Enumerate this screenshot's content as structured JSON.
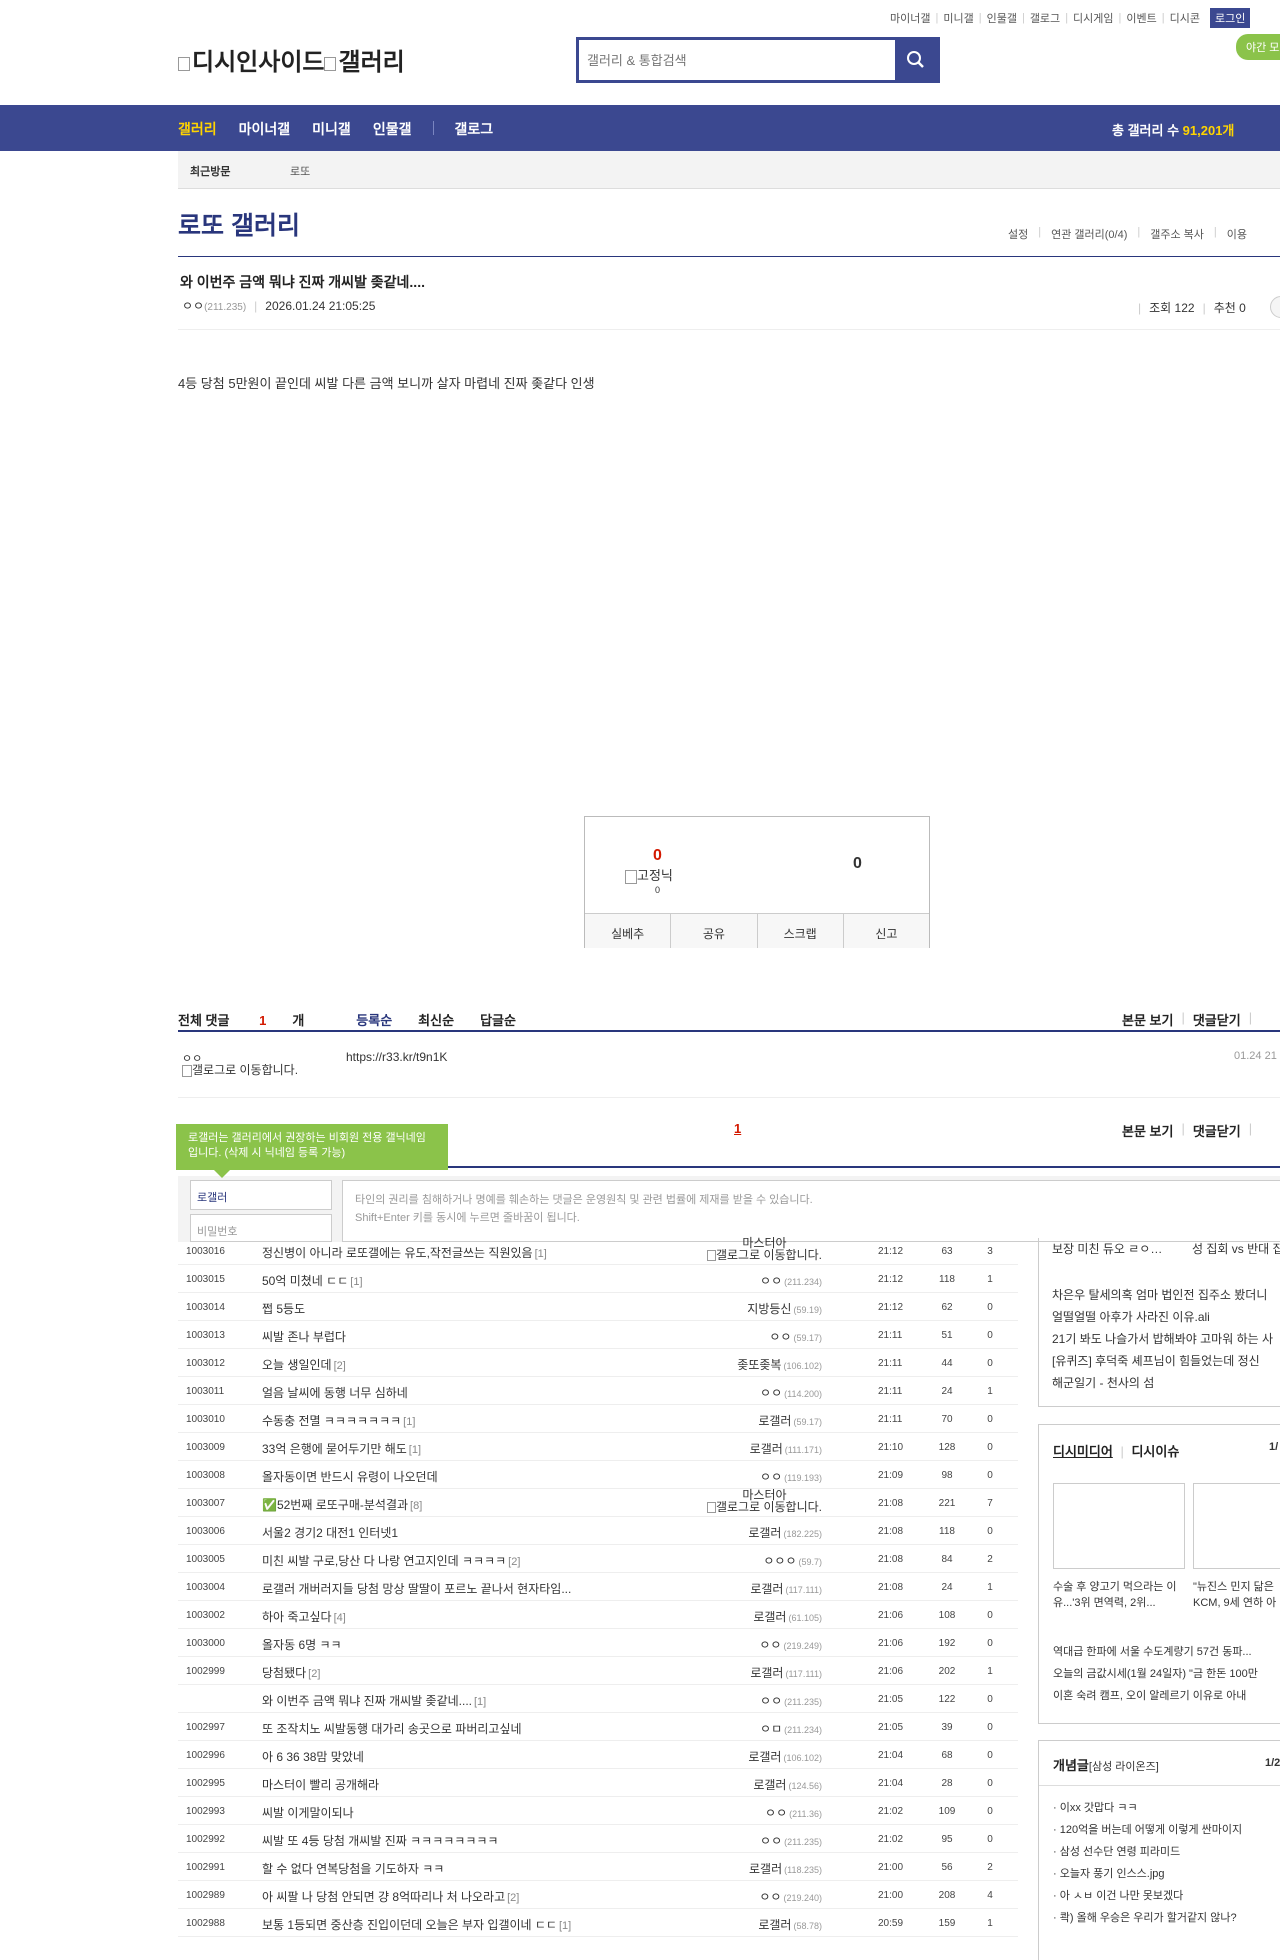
{
  "top_links": [
    "마이너갤",
    "미니갤",
    "인물갤",
    "갤로그",
    "디시게임",
    "이벤트",
    "디시콘"
  ],
  "login_label": "로그인",
  "night_mode_label": "야간 모드",
  "logo_alt_1": "디시인사이드",
  "logo_alt_2": "갤러리",
  "search_placeholder": "갤러리 & 통합검색",
  "nav": {
    "items": [
      "갤러리",
      "마이너갤",
      "미니갤",
      "인물갤",
      "갤로그"
    ],
    "total_prefix": "총 갤러리 수",
    "total_value": "91,201개"
  },
  "recent": {
    "label": "최근방문",
    "item": "로또"
  },
  "gallery": {
    "title": "로또 갤러리",
    "menu": [
      "설정",
      "연관 갤러리(0/4)",
      "갤주소 복사",
      "이용"
    ]
  },
  "post": {
    "title": "와 이번주 금액 뭐냐 진짜 개씨발 좆같네....",
    "author": "ㅇㅇ",
    "author_ip": "(211.235)",
    "date": "2026.01.24 21:05:25",
    "views_label": "조회 122",
    "recommend_label": "추천 0",
    "body": "4등 당첨 5만원이 끝인데 씨발 다른 금액 보니까 살자 마렵네 진짜 좆같다 인생"
  },
  "recommend_box": {
    "up_count": "0",
    "fixed_nick_alt": "고정닉",
    "fixed_count": "0",
    "down_count": "0",
    "buttons": [
      "실베추",
      "공유",
      "스크랩",
      "신고"
    ]
  },
  "comments": {
    "total_label": "전체 댓글",
    "total_count": "1",
    "total_unit": "개",
    "sort": [
      "등록순",
      "최신순",
      "답글순"
    ],
    "actions": [
      "본문 보기",
      "댓글닫기"
    ],
    "item": {
      "nick": "ㅇㅇ",
      "gallog_alt": "갤로그로 이동합니다.",
      "text": "https://r33.kr/t9n1K",
      "date": "01.24 21"
    },
    "page": "1",
    "tooltip": "로갤러는 갤러리에서 권장하는 비회원 전용 갤닉네임입니다. (삭제 시 닉네임 등록 가능)",
    "nick_input": "로갤러",
    "password_placeholder": "비밀번호",
    "textarea_line1": "타인의 권리를 침해하거나 명예를 훼손하는 댓글은 운영원칙 및 관련 법률에 제재를 받을 수 있습니다.",
    "textarea_line2": "Shift+Enter 키를 동시에 누르면 줄바꿈이 됩니다."
  },
  "list": [
    {
      "no": "1003016",
      "title": "정신병이 아니라 로또갤에는 유도,작전글쓰는 직원있음",
      "reply": "[1]",
      "writer": "마스터아",
      "writer2": "갤로그로 이동합니다.",
      "ip": "",
      "date": "21:12",
      "views": "63",
      "rec": "3"
    },
    {
      "no": "1003015",
      "title": "50억 미쳤네 ㄷㄷ",
      "reply": "[1]",
      "writer": "ㅇㅇ",
      "ip": "(211.234)",
      "date": "21:12",
      "views": "118",
      "rec": "1"
    },
    {
      "no": "1003014",
      "title": "쩝 5등도",
      "reply": "",
      "writer": "지방등신",
      "ip": "(59.19)",
      "date": "21:12",
      "views": "62",
      "rec": "0"
    },
    {
      "no": "1003013",
      "title": "씨발 존나 부럽다",
      "reply": "",
      "writer": "ㅇㅇ",
      "ip": "(59.17)",
      "date": "21:11",
      "views": "51",
      "rec": "0"
    },
    {
      "no": "1003012",
      "title": "오늘 생일인데",
      "reply": "[2]",
      "writer": "좆또좆복",
      "ip": "(106.102)",
      "date": "21:11",
      "views": "44",
      "rec": "0"
    },
    {
      "no": "1003011",
      "title": "얼음 날씨에 동행 너무 심하네",
      "reply": "",
      "writer": "ㅇㅇ",
      "ip": "(114.200)",
      "date": "21:11",
      "views": "24",
      "rec": "1"
    },
    {
      "no": "1003010",
      "title": "수동충 전멸 ㅋㅋㅋㅋㅋㅋㅋ",
      "reply": "[1]",
      "writer": "로갤러",
      "ip": "(59.17)",
      "date": "21:11",
      "views": "70",
      "rec": "0"
    },
    {
      "no": "1003009",
      "title": "33억 은행에 묻어두기만 해도",
      "reply": "[1]",
      "writer": "로갤러",
      "ip": "(111.171)",
      "date": "21:10",
      "views": "128",
      "rec": "0"
    },
    {
      "no": "1003008",
      "title": "올자동이면 반드시 유령이 나오던데",
      "reply": "",
      "writer": "ㅇㅇ",
      "ip": "(119.193)",
      "date": "21:09",
      "views": "98",
      "rec": "0"
    },
    {
      "no": "1003007",
      "title": "✅52번째 로또구매-분석결과",
      "reply": "[8]",
      "writer": "마스터아",
      "writer2": "갤로그로 이동합니다.",
      "ip": "",
      "date": "21:08",
      "views": "221",
      "rec": "7"
    },
    {
      "no": "1003006",
      "title": "서울2 경기2 대전1 인터넷1",
      "reply": "",
      "writer": "로갤러",
      "ip": "(182.225)",
      "date": "21:08",
      "views": "118",
      "rec": "0"
    },
    {
      "no": "1003005",
      "title": "미친 씨발 구로,당산 다 나랑 연고지인데 ㅋㅋㅋㅋ",
      "reply": "[2]",
      "writer": "ㅇㅇㅇ",
      "ip": "(59.7)",
      "date": "21:08",
      "views": "84",
      "rec": "2"
    },
    {
      "no": "1003004",
      "title": "로갤러 개버러지들 당첨 망상 딸딸이 포르노 끝나서 현자타임...",
      "reply": "",
      "writer": "로갤러",
      "ip": "(117.111)",
      "date": "21:08",
      "views": "24",
      "rec": "1"
    },
    {
      "no": "1003002",
      "title": "하아 죽고싶다",
      "reply": "[4]",
      "writer": "로갤러",
      "ip": "(61.105)",
      "date": "21:06",
      "views": "108",
      "rec": "0"
    },
    {
      "no": "1003000",
      "title": "올자동 6명 ㅋㅋ",
      "reply": "",
      "writer": "ㅇㅇ",
      "ip": "(219.249)",
      "date": "21:06",
      "views": "192",
      "rec": "0"
    },
    {
      "no": "1002999",
      "title": "당첨됐다",
      "reply": "[2]",
      "writer": "로갤러",
      "ip": "(117.111)",
      "date": "21:06",
      "views": "202",
      "rec": "1"
    },
    {
      "no": "",
      "title": "와 이번주 금액 뭐냐 진짜 개씨발 좆같네....",
      "reply": "[1]",
      "writer": "ㅇㅇ",
      "ip": "(211.235)",
      "date": "21:05",
      "views": "122",
      "rec": "0"
    },
    {
      "no": "1002997",
      "title": "또 조작치노 씨발동행 대가리 송곳으로 파버리고싶네",
      "reply": "",
      "writer": "ㅇㅁ",
      "ip": "(211.234)",
      "date": "21:05",
      "views": "39",
      "rec": "0"
    },
    {
      "no": "1002996",
      "title": "아 6 36 38맘 맞았네",
      "reply": "",
      "writer": "로갤러",
      "ip": "(106.102)",
      "date": "21:04",
      "views": "68",
      "rec": "0"
    },
    {
      "no": "1002995",
      "title": "마스터이 빨리 공개해라",
      "reply": "",
      "writer": "로갤러",
      "ip": "(124.56)",
      "date": "21:04",
      "views": "28",
      "rec": "0"
    },
    {
      "no": "1002993",
      "title": "씨발 이게말이되나",
      "reply": "",
      "writer": "ㅇㅇ",
      "ip": "(211.36)",
      "date": "21:02",
      "views": "109",
      "rec": "0"
    },
    {
      "no": "1002992",
      "title": "씨발 또 4등 당첨 개씨발 진짜 ㅋㅋㅋㅋㅋㅋㅋㅋ",
      "reply": "",
      "writer": "ㅇㅇ",
      "ip": "(211.235)",
      "date": "21:02",
      "views": "95",
      "rec": "0"
    },
    {
      "no": "1002991",
      "title": "할 수 없다 연복당첨을 기도하자 ㅋㅋ",
      "reply": "",
      "writer": "로갤러",
      "ip": "(118.235)",
      "date": "21:00",
      "views": "56",
      "rec": "2"
    },
    {
      "no": "1002989",
      "title": "아 씨팔 나 당첨 안되면 걍 8억따리나 처 나오라고",
      "reply": "[2]",
      "writer": "ㅇㅇ",
      "ip": "(219.240)",
      "date": "21:00",
      "views": "208",
      "rec": "4"
    },
    {
      "no": "1002988",
      "title": "보통 1등되면 중산층 진입이던데 오늘은 부자 입갤이네 ㄷㄷ",
      "reply": "[1]",
      "writer": "로갤러",
      "ip": "(58.78)",
      "date": "20:59",
      "views": "159",
      "rec": "1"
    }
  ],
  "sidebar": {
    "top_lines": [
      "보장 미친 듀오 ㄹㅇ…",
      "성 집회 vs 반대 집",
      "차은우 탈세의혹 엄마 법인전 집주소 봤더니",
      "얼떨얼떨 아후가 사라진 이유.ali",
      "21기 봐도 나슬가서 밥해봐야 고마워 하는 사",
      "[유퀴즈] 후덕죽 셰프님이 힘들었는데 정신",
      "해군일기 - 천사의 섬"
    ],
    "media": {
      "tab1": "디시미디어",
      "tab2": "디시이슈",
      "page": "1/",
      "caption1": "수술 후 양고기 먹으라는 이유...'3위 면역력, 2위...",
      "caption2": "\"뉴진스 민지 닮은 KCM, 9세 연하 아",
      "lines": [
        "역대급 한파에 서울 수도계량기 57건 동파...",
        "오늘의 금값시세(1월 24일자) \"금 한돈 100만",
        "이혼 숙려 캠프, 오이 알레르기 이유로 아내"
      ]
    },
    "concept": {
      "title": "개념글",
      "sponsor": "[삼성 라이온즈]",
      "page": "1/2",
      "items": [
        "이xx 갓맙다 ㅋㅋ",
        "120억을 버는데 어떻게 이렇게 싼마이지",
        "삼성 선수단 연령 피라미드",
        "오늘자 풍기 인스스.jpg",
        "아 ㅅㅂ 이건 나만 못보겠다",
        "콱) 올해 우승은 우리가 할거같지 않나?"
      ]
    }
  }
}
